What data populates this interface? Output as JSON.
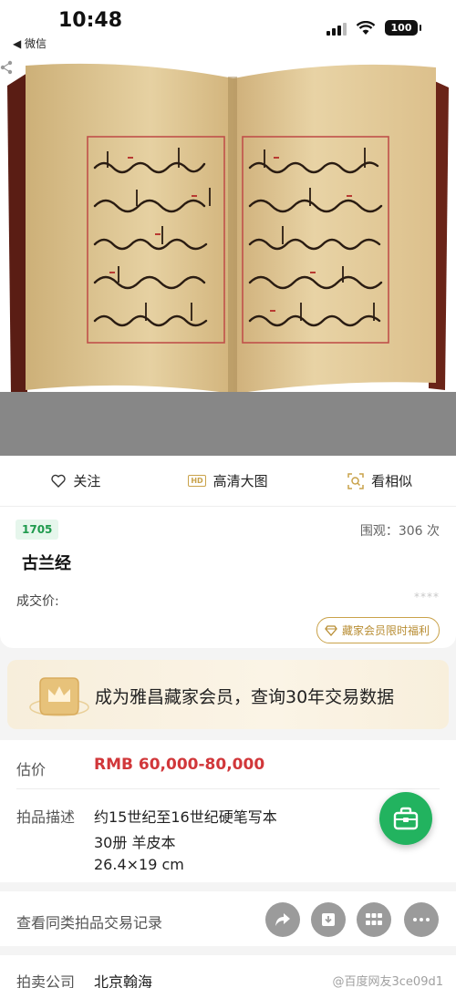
{
  "status_bar": {
    "time": "10:48",
    "back_app": "◀ 微信",
    "battery": "100"
  },
  "actions": [
    {
      "label": "关注",
      "icon": "heart-icon"
    },
    {
      "label": "高清大图",
      "icon": "hd-icon",
      "badge": "HD"
    },
    {
      "label": "看相似",
      "icon": "similar-search-icon"
    }
  ],
  "lot": {
    "number": "1705",
    "views": "围观：306 次",
    "title": "古兰经",
    "deal_label": "成交价:",
    "deal_value": "****",
    "benefit_label": "藏家会员限时福利"
  },
  "member_banner": {
    "text": "成为雅昌藏家会员，查询30年交易数据"
  },
  "details": {
    "estimate_label": "估价",
    "estimate_value": "RMB  60,000-80,000",
    "description_label": "拍品描述",
    "description_lines": [
      "约15世纪至16世纪硬笔写本",
      "30册  羊皮本",
      "26.4×19 cm"
    ]
  },
  "record_bar": {
    "text": "查看同类拍品交易记录"
  },
  "auction_house": {
    "label": "拍卖公司",
    "value": "北京翰海"
  },
  "watermark": "@百度网友3ce09d1",
  "colors": {
    "accent_green": "#22b35f",
    "price_red": "#d1373a",
    "gold": "#c9a24a"
  }
}
